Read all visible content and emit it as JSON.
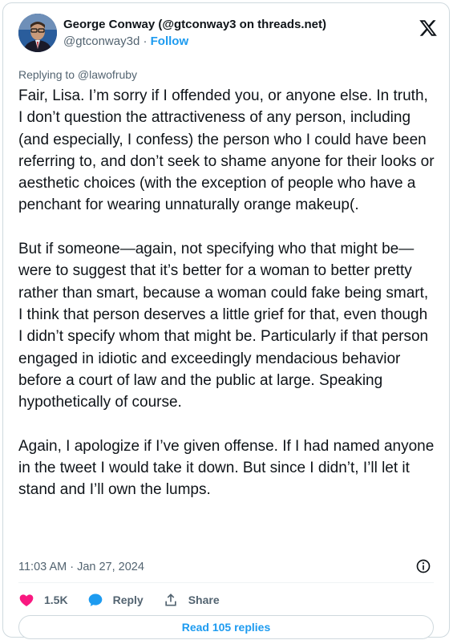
{
  "author": {
    "display_name": "George Conway (@gtconway3 on threads.net)",
    "handle": "@gtconway3d",
    "separator": "·",
    "follow_label": "Follow",
    "avatar_icon": "avatar-photo"
  },
  "platform_icon": "x-logo-icon",
  "replying_to": "Replying to @lawofruby",
  "tweet": {
    "paragraphs": [
      "Fair, Lisa. I’m sorry if I offended you, or anyone else. In truth, I don’t question the attractiveness of any person, including (and especially, I confess) the person who I could have been referring to, and don’t seek to shame anyone for their looks or aesthetic choices (with the exception of people who have a penchant for wearing unnaturally orange makeup(.",
      "But if someone—again, not specifying who that might be—were to suggest that it’s better for a woman to better pretty rather than smart, because a woman could fake being smart, I think that person deserves a little grief for that, even though I didn’t specify whom that might be. Particularly if that person engaged in idiotic and exceedingly mendacious behavior before a court of law and the public at large. Speaking hypothetically of course.",
      "Again, I apologize if I’ve given offense. If I had named anyone in the tweet I would take it down. But since I didn’t, I’ll let it stand and I’ll own the lumps."
    ],
    "timestamp": "11:03 AM · Jan 27, 2024"
  },
  "actions": {
    "likes_count": "1.5K",
    "reply_label": "Reply",
    "share_label": "Share"
  },
  "read_replies_label": "Read 105 replies",
  "colors": {
    "accent": "#1d9bf0",
    "like": "#f91880",
    "secondary_text": "#536471"
  }
}
